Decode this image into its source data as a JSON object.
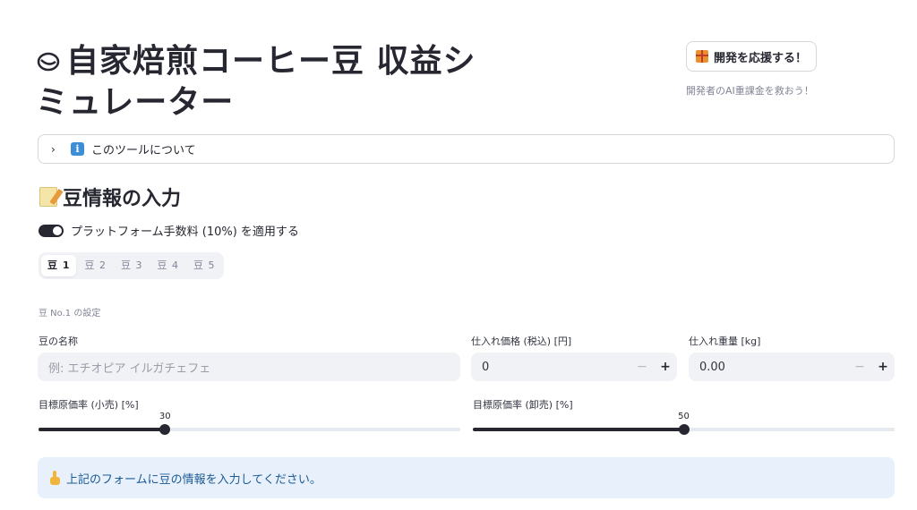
{
  "header": {
    "title": "自家焙煎コーヒー豆 収益シミュレーター",
    "support_button": "開発を応援する！",
    "support_caption": "開発者のAI重課金を救おう！"
  },
  "expander": {
    "label": "このツールについて"
  },
  "section": {
    "heading": "豆情報の入力"
  },
  "toggle": {
    "label": "プラットフォーム手数料 (10%) を適用する",
    "on": true
  },
  "tabs": [
    "豆 1",
    "豆 2",
    "豆 3",
    "豆 4",
    "豆 5"
  ],
  "active_tab": 0,
  "bean_caption": "豆 No.1 の設定",
  "fields": {
    "name": {
      "label": "豆の名称",
      "placeholder": "例: エチオピア イルガチェフェ"
    },
    "price": {
      "label": "仕入れ価格 (税込) [円]",
      "value": "0",
      "minus": "−",
      "plus": "+"
    },
    "weight": {
      "label": "仕入れ重量 [kg]",
      "value": "0.00",
      "minus": "−",
      "plus": "+"
    }
  },
  "sliders": {
    "retail": {
      "label": "目標原価率 (小売) [%]",
      "value": 30,
      "min": 0,
      "max": 100
    },
    "wholesale": {
      "label": "目標原価率 (卸売) [%]",
      "value": 50,
      "min": 0,
      "max": 100
    }
  },
  "alert": {
    "text": "上記のフォームに豆の情報を入力してください。"
  },
  "colors": {
    "primary": "#262730",
    "alert_bg": "#e8f1fb",
    "alert_text": "#1c5a94",
    "input_bg": "#f0f2f6"
  }
}
